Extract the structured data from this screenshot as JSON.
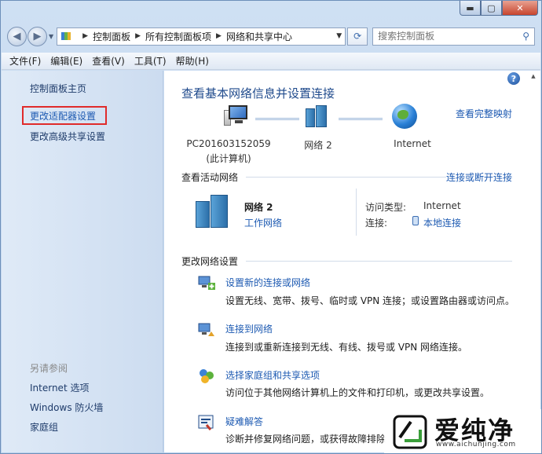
{
  "window": {
    "caption": {
      "minimize": "▬",
      "maximize": "▢",
      "close": "✕"
    }
  },
  "navigation": {
    "back": "◀",
    "forward": "▶",
    "breadcrumbs": [
      "控制面板",
      "所有控制面板项",
      "网络和共享中心"
    ],
    "search_placeholder": "搜索控制面板"
  },
  "menu": [
    "文件(F)",
    "编辑(E)",
    "查看(V)",
    "工具(T)",
    "帮助(H)"
  ],
  "sidebar": {
    "home": "控制面板主页",
    "items": [
      "更改适配器设置",
      "更改高级共享设置"
    ],
    "see_also_title": "另请参阅",
    "see_also": [
      "Internet 选项",
      "Windows 防火墙",
      "家庭组"
    ]
  },
  "main": {
    "title": "查看基本网络信息并设置连接",
    "full_map_link": "查看完整映射",
    "map": {
      "computer_name": "PC201603152059",
      "computer_sub": "(此计算机)",
      "network": "网络  2",
      "internet": "Internet"
    },
    "active_section": {
      "title": "查看活动网络",
      "connect_link": "连接或断开连接",
      "network_name": "网络  2",
      "network_type": "工作网络",
      "access_label": "访问类型:",
      "access_value": "Internet",
      "connection_label": "连接:",
      "connection_value": "本地连接"
    },
    "change_section": {
      "title": "更改网络设置",
      "tasks": [
        {
          "link": "设置新的连接或网络",
          "desc": "设置无线、宽带、拨号、临时或 VPN 连接；或设置路由器或访问点。",
          "icon": "new-connection-icon"
        },
        {
          "link": "连接到网络",
          "desc": "连接到或重新连接到无线、有线、拨号或 VPN 网络连接。",
          "icon": "connect-network-icon"
        },
        {
          "link": "选择家庭组和共享选项",
          "desc": "访问位于其他网络计算机上的文件和打印机，或更改共享设置。",
          "icon": "homegroup-icon"
        },
        {
          "link": "疑难解答",
          "desc": "诊断并修复网络问题，或获得故障排除",
          "icon": "troubleshoot-icon"
        }
      ]
    }
  },
  "watermark": {
    "title": "爱纯净",
    "url": "www.aichunjing.com"
  },
  "colors": {
    "link": "#1d5ab2",
    "highlight_box": "#e02b2b",
    "sidebar": "#d6e4f4"
  }
}
